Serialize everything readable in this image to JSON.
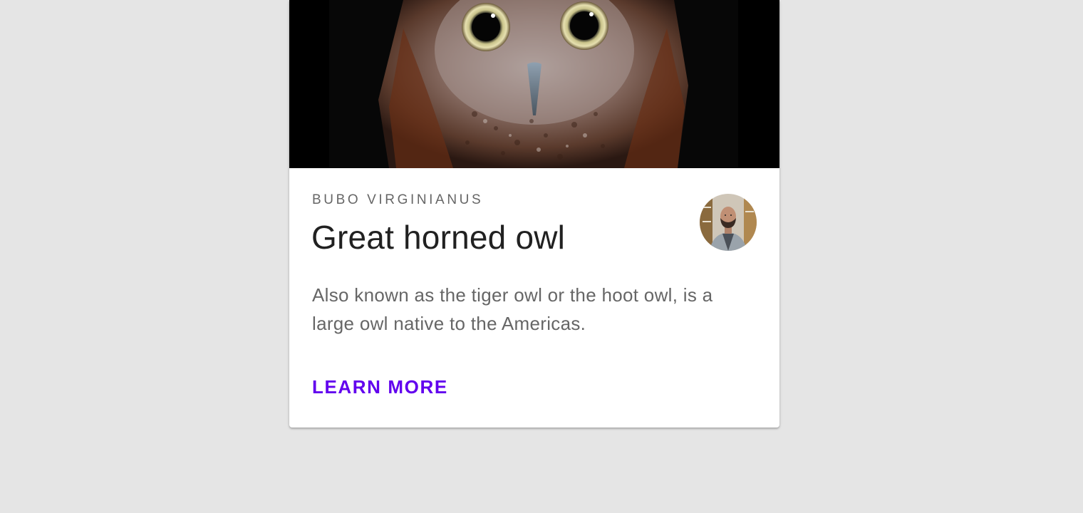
{
  "card": {
    "overline": "BUBO VIRGINIANUS",
    "title": "Great horned owl",
    "description": "Also known as the tiger owl or the hoot owl, is a large owl native to the Americas.",
    "action_label": "LEARN MORE"
  },
  "colors": {
    "background": "#e5e5e5",
    "card": "#ffffff",
    "accent": "#6200ee",
    "title": "#212121",
    "secondary_text": "#666666"
  },
  "icons": {
    "media": "owl-photo",
    "avatar": "user-avatar"
  }
}
